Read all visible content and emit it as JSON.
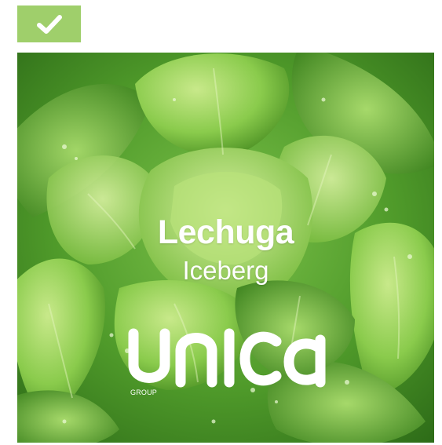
{
  "toolbar": {
    "check_icon": "check-icon",
    "accent": "#9fcf6b"
  },
  "product": {
    "title": "Lechuga",
    "subtitle": "Iceberg",
    "brand": "unica",
    "brand_group": "GROUP",
    "image_subject": "lettuce-photo"
  }
}
